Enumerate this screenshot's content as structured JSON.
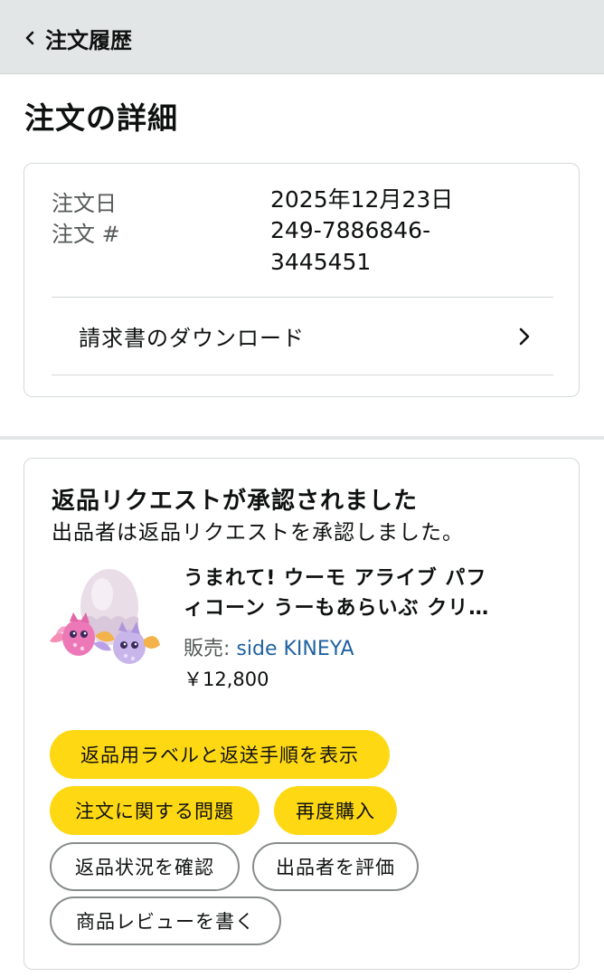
{
  "header": {
    "back_label": "注文履歴"
  },
  "page_title": "注文の詳細",
  "order_info": {
    "date_label": "注文日",
    "date_value": "2025年12月23日",
    "number_label": "注文 #",
    "number_line1": "249-7886846-",
    "number_line2": "3445451",
    "download_label": "請求書のダウンロード"
  },
  "status": {
    "title": "返品リクエストが承認されました",
    "subtitle": "出品者は返品リクエストを承認しました。"
  },
  "product": {
    "title_line1": "うまれて! ウーモ アライブ パフ",
    "title_line2": "ィコーン うーもあらいぶ クリ…",
    "seller_prefix": "販売: ",
    "seller_name": "side KINEYA",
    "price": "￥12,800"
  },
  "buttons": {
    "return_label": "返品用ラベルと返送手順を表示",
    "order_issue": "注文に関する問題",
    "buy_again": "再度購入",
    "check_return": "返品状況を確認",
    "rate_seller": "出品者を評価",
    "write_review": "商品レビューを書く"
  },
  "colors": {
    "accent_yellow": "#ffd814",
    "link_blue": "#2162a1",
    "header_bg": "#e3e6e6"
  },
  "icons": {
    "back": "chevron-left-icon",
    "download": "chevron-right-icon"
  }
}
